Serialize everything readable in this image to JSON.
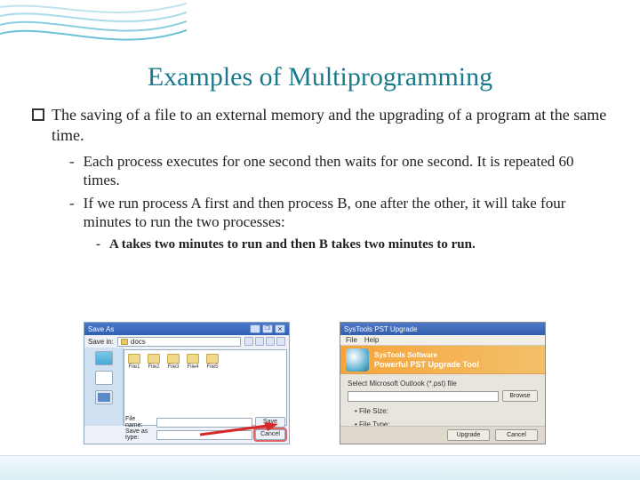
{
  "title": "Examples of Multiprogramming",
  "main_bullet": "The saving of a file to an external memory and the upgrading of a program at the same time.",
  "sub": [
    "Each process executes for one second then waits for one second. It is repeated 60 times.",
    "If we run process A first and then process B, one after the other, it will take four minutes to run the two processes:"
  ],
  "subsub": "A takes two minutes to run and then B takes two minutes to run.",
  "dlg1": {
    "title": "Save As",
    "savein_label": "Save in:",
    "location": "docs",
    "side": [
      "Desktop",
      "Documents",
      "Computer"
    ],
    "files": [
      "File1",
      "File2",
      "File3",
      "File4",
      "File5"
    ],
    "fname_label": "File name:",
    "ftype_label": "Save as type:",
    "fname_value": "",
    "ftype_value": "",
    "save_btn": "Save",
    "cancel_btn": "Cancel"
  },
  "dlg2": {
    "title": "SysTools PST Upgrade",
    "menu": [
      "File",
      "Help"
    ],
    "brand": "SysTools Software",
    "product": "Powerful PST Upgrade Tool",
    "select_label": "Select Microsoft Outlook (*.pst) file",
    "browse": "Browse",
    "kv": [
      {
        "k": "• File Size:",
        "v": ""
      },
      {
        "k": "• File Type:",
        "v": ""
      }
    ],
    "upgrade_btn": "Upgrade",
    "cancel_btn": "Cancel"
  }
}
